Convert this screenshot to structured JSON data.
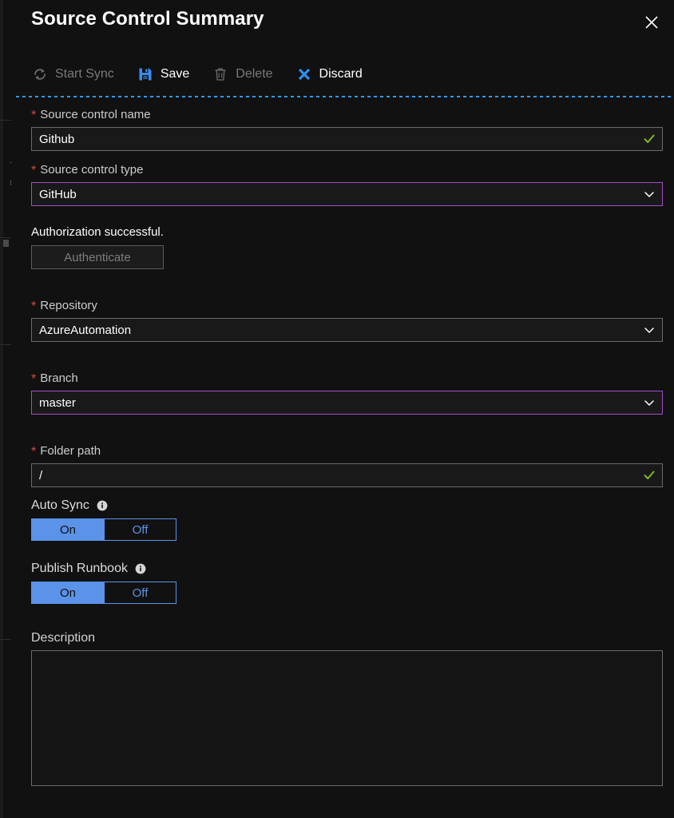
{
  "background_blade": {
    "glyph_line_1": "«",
    "glyph_line_2": "≡"
  },
  "panel": {
    "title": "Source Control Summary",
    "close_icon": "close-icon"
  },
  "toolbar": {
    "commands": [
      {
        "label": "Start Sync",
        "icon": "sync-icon",
        "enabled": false
      },
      {
        "label": "Save",
        "icon": "save-icon",
        "enabled": true
      },
      {
        "label": "Delete",
        "icon": "trash-icon",
        "enabled": false
      },
      {
        "label": "Discard",
        "icon": "discard-x-icon",
        "enabled": true
      }
    ]
  },
  "form": {
    "source_control_name": {
      "label": "Source control name",
      "required": true,
      "value": "Github",
      "placeholder": "",
      "state": "valid",
      "affix_icon": "checkmark-icon"
    },
    "source_control_type": {
      "label": "Source control type",
      "required": true,
      "value": "GitHub",
      "state": "focused",
      "affix_icon": "chevron-down-icon",
      "options": [
        "GitHub"
      ]
    },
    "authorization": {
      "status_text": "Authorization successful.",
      "button_label": "Authenticate",
      "button_enabled": false
    },
    "repository": {
      "label": "Repository",
      "required": true,
      "value": "AzureAutomation",
      "state": "normal",
      "affix_icon": "chevron-down-icon",
      "options": [
        "AzureAutomation"
      ]
    },
    "branch": {
      "label": "Branch",
      "required": true,
      "value": "master",
      "state": "focused",
      "affix_icon": "chevron-down-icon",
      "options": [
        "master"
      ]
    },
    "folder_path": {
      "label": "Folder path",
      "required": true,
      "value": "/",
      "state": "valid",
      "affix_icon": "checkmark-icon"
    },
    "auto_sync": {
      "label": "Auto Sync",
      "info_icon": "info-icon",
      "on_label": "On",
      "off_label": "Off",
      "selected": "On"
    },
    "publish_runbook": {
      "label": "Publish Runbook",
      "info_icon": "info-icon",
      "on_label": "On",
      "off_label": "Off",
      "selected": "On"
    },
    "description": {
      "label": "Description",
      "value": "",
      "placeholder": ""
    }
  },
  "colors": {
    "panel_background": "#111111",
    "accent_blue": "#5a93e8",
    "focus_purple": "#a04fc8",
    "valid_green": "#7fba2a",
    "required_red": "#e04545",
    "separator_blue": "#2f9bea"
  }
}
